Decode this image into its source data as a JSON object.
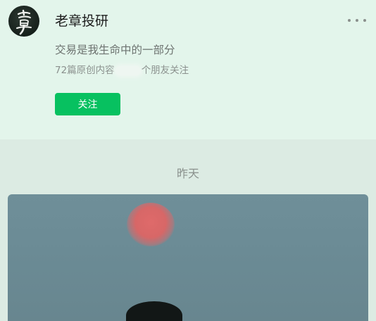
{
  "account": {
    "name": "老章投研",
    "avatar_glyph": "章",
    "bio": "交易是我生命中的一部分",
    "stats_prefix": "72篇原创内容",
    "stats_suffix": "个朋友关注"
  },
  "actions": {
    "follow_label": "关注",
    "more_icon": "more-dots-icon"
  },
  "feed": {
    "date_label": "昨天"
  },
  "colors": {
    "follow_button": "#07c160",
    "profile_background": "#e3f5eb",
    "feed_background": "#dcebe3"
  }
}
